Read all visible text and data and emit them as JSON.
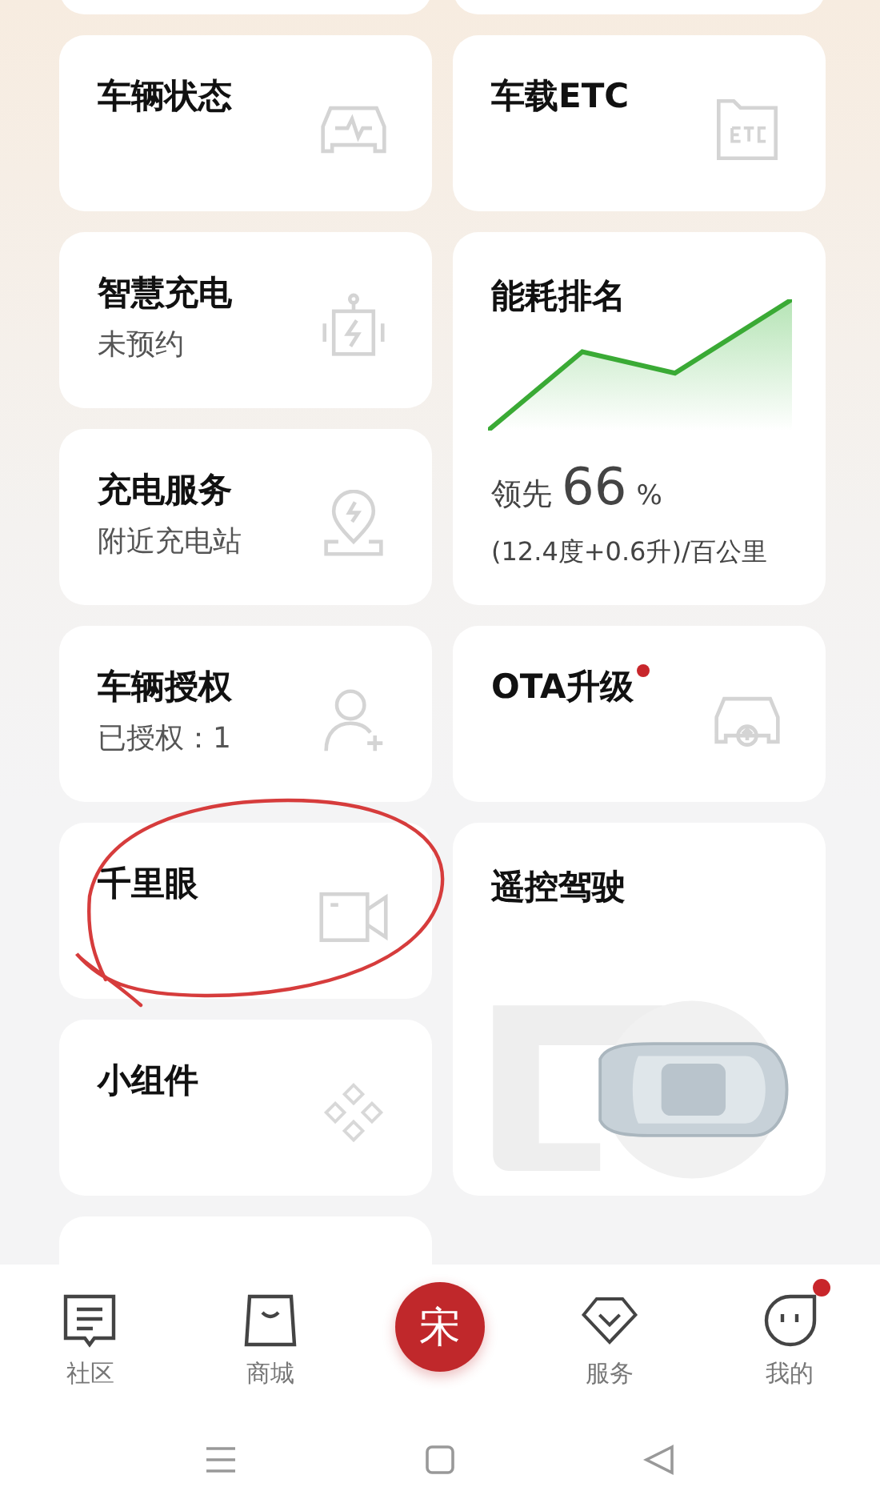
{
  "left_column": [
    {
      "kind": "blank"
    },
    {
      "kind": "feature",
      "title": "车辆状态"
    },
    {
      "kind": "feature",
      "title": "智慧充电",
      "subtitle": "未预约"
    },
    {
      "kind": "feature",
      "title": "充电服务",
      "subtitle": "附近充电站"
    },
    {
      "kind": "feature",
      "title": "车辆授权",
      "subtitle": "已授权：1"
    },
    {
      "kind": "feature",
      "title": "千里眼"
    },
    {
      "kind": "feature",
      "title": "小组件"
    },
    {
      "kind": "blank"
    }
  ],
  "right_column": [
    {
      "kind": "blank"
    },
    {
      "kind": "feature",
      "title": "车载ETC"
    },
    {
      "kind": "energy",
      "title": "能耗排名",
      "lead_label": "领先",
      "value": "66",
      "unit": "%",
      "detail": "(12.4度+0.6升)/百公里"
    },
    {
      "kind": "feature",
      "title": "OTA升级",
      "badge": true
    },
    {
      "kind": "remote",
      "title": "遥控驾驶"
    }
  ],
  "annotation": {
    "kind": "circle"
  },
  "nav": [
    {
      "kind": "tab",
      "label": "社区",
      "badge": false
    },
    {
      "kind": "tab",
      "label": "商城",
      "badge": false
    },
    {
      "kind": "center",
      "label": "宋"
    },
    {
      "kind": "tab",
      "label": "服务",
      "badge": false
    },
    {
      "kind": "tab",
      "label": "我的",
      "badge": true
    }
  ]
}
